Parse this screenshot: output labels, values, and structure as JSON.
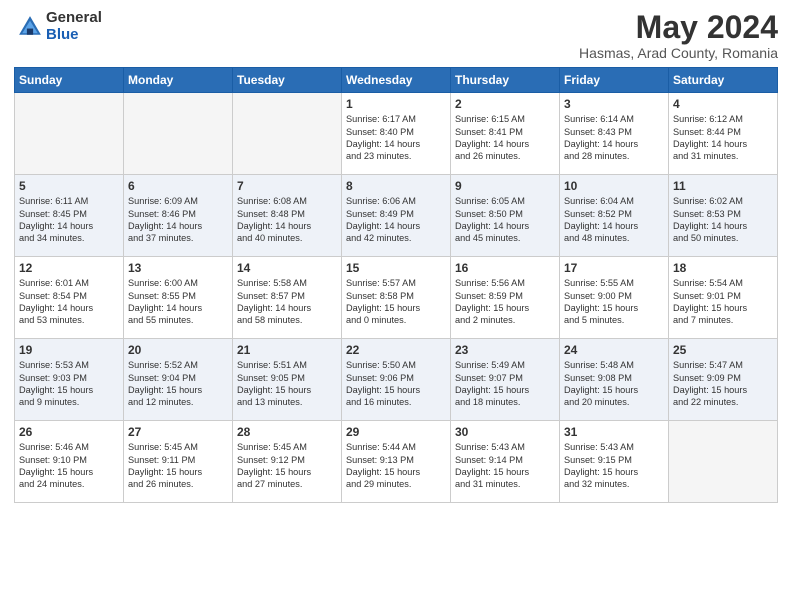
{
  "logo": {
    "general": "General",
    "blue": "Blue"
  },
  "title": {
    "month_year": "May 2024",
    "location": "Hasmas, Arad County, Romania"
  },
  "weekdays": [
    "Sunday",
    "Monday",
    "Tuesday",
    "Wednesday",
    "Thursday",
    "Friday",
    "Saturday"
  ],
  "weeks": [
    [
      {
        "day": "",
        "text": ""
      },
      {
        "day": "",
        "text": ""
      },
      {
        "day": "",
        "text": ""
      },
      {
        "day": "1",
        "text": "Sunrise: 6:17 AM\nSunset: 8:40 PM\nDaylight: 14 hours\nand 23 minutes."
      },
      {
        "day": "2",
        "text": "Sunrise: 6:15 AM\nSunset: 8:41 PM\nDaylight: 14 hours\nand 26 minutes."
      },
      {
        "day": "3",
        "text": "Sunrise: 6:14 AM\nSunset: 8:43 PM\nDaylight: 14 hours\nand 28 minutes."
      },
      {
        "day": "4",
        "text": "Sunrise: 6:12 AM\nSunset: 8:44 PM\nDaylight: 14 hours\nand 31 minutes."
      }
    ],
    [
      {
        "day": "5",
        "text": "Sunrise: 6:11 AM\nSunset: 8:45 PM\nDaylight: 14 hours\nand 34 minutes."
      },
      {
        "day": "6",
        "text": "Sunrise: 6:09 AM\nSunset: 8:46 PM\nDaylight: 14 hours\nand 37 minutes."
      },
      {
        "day": "7",
        "text": "Sunrise: 6:08 AM\nSunset: 8:48 PM\nDaylight: 14 hours\nand 40 minutes."
      },
      {
        "day": "8",
        "text": "Sunrise: 6:06 AM\nSunset: 8:49 PM\nDaylight: 14 hours\nand 42 minutes."
      },
      {
        "day": "9",
        "text": "Sunrise: 6:05 AM\nSunset: 8:50 PM\nDaylight: 14 hours\nand 45 minutes."
      },
      {
        "day": "10",
        "text": "Sunrise: 6:04 AM\nSunset: 8:52 PM\nDaylight: 14 hours\nand 48 minutes."
      },
      {
        "day": "11",
        "text": "Sunrise: 6:02 AM\nSunset: 8:53 PM\nDaylight: 14 hours\nand 50 minutes."
      }
    ],
    [
      {
        "day": "12",
        "text": "Sunrise: 6:01 AM\nSunset: 8:54 PM\nDaylight: 14 hours\nand 53 minutes."
      },
      {
        "day": "13",
        "text": "Sunrise: 6:00 AM\nSunset: 8:55 PM\nDaylight: 14 hours\nand 55 minutes."
      },
      {
        "day": "14",
        "text": "Sunrise: 5:58 AM\nSunset: 8:57 PM\nDaylight: 14 hours\nand 58 minutes."
      },
      {
        "day": "15",
        "text": "Sunrise: 5:57 AM\nSunset: 8:58 PM\nDaylight: 15 hours\nand 0 minutes."
      },
      {
        "day": "16",
        "text": "Sunrise: 5:56 AM\nSunset: 8:59 PM\nDaylight: 15 hours\nand 2 minutes."
      },
      {
        "day": "17",
        "text": "Sunrise: 5:55 AM\nSunset: 9:00 PM\nDaylight: 15 hours\nand 5 minutes."
      },
      {
        "day": "18",
        "text": "Sunrise: 5:54 AM\nSunset: 9:01 PM\nDaylight: 15 hours\nand 7 minutes."
      }
    ],
    [
      {
        "day": "19",
        "text": "Sunrise: 5:53 AM\nSunset: 9:03 PM\nDaylight: 15 hours\nand 9 minutes."
      },
      {
        "day": "20",
        "text": "Sunrise: 5:52 AM\nSunset: 9:04 PM\nDaylight: 15 hours\nand 12 minutes."
      },
      {
        "day": "21",
        "text": "Sunrise: 5:51 AM\nSunset: 9:05 PM\nDaylight: 15 hours\nand 13 minutes."
      },
      {
        "day": "22",
        "text": "Sunrise: 5:50 AM\nSunset: 9:06 PM\nDaylight: 15 hours\nand 16 minutes."
      },
      {
        "day": "23",
        "text": "Sunrise: 5:49 AM\nSunset: 9:07 PM\nDaylight: 15 hours\nand 18 minutes."
      },
      {
        "day": "24",
        "text": "Sunrise: 5:48 AM\nSunset: 9:08 PM\nDaylight: 15 hours\nand 20 minutes."
      },
      {
        "day": "25",
        "text": "Sunrise: 5:47 AM\nSunset: 9:09 PM\nDaylight: 15 hours\nand 22 minutes."
      }
    ],
    [
      {
        "day": "26",
        "text": "Sunrise: 5:46 AM\nSunset: 9:10 PM\nDaylight: 15 hours\nand 24 minutes."
      },
      {
        "day": "27",
        "text": "Sunrise: 5:45 AM\nSunset: 9:11 PM\nDaylight: 15 hours\nand 26 minutes."
      },
      {
        "day": "28",
        "text": "Sunrise: 5:45 AM\nSunset: 9:12 PM\nDaylight: 15 hours\nand 27 minutes."
      },
      {
        "day": "29",
        "text": "Sunrise: 5:44 AM\nSunset: 9:13 PM\nDaylight: 15 hours\nand 29 minutes."
      },
      {
        "day": "30",
        "text": "Sunrise: 5:43 AM\nSunset: 9:14 PM\nDaylight: 15 hours\nand 31 minutes."
      },
      {
        "day": "31",
        "text": "Sunrise: 5:43 AM\nSunset: 9:15 PM\nDaylight: 15 hours\nand 32 minutes."
      },
      {
        "day": "",
        "text": ""
      }
    ]
  ]
}
